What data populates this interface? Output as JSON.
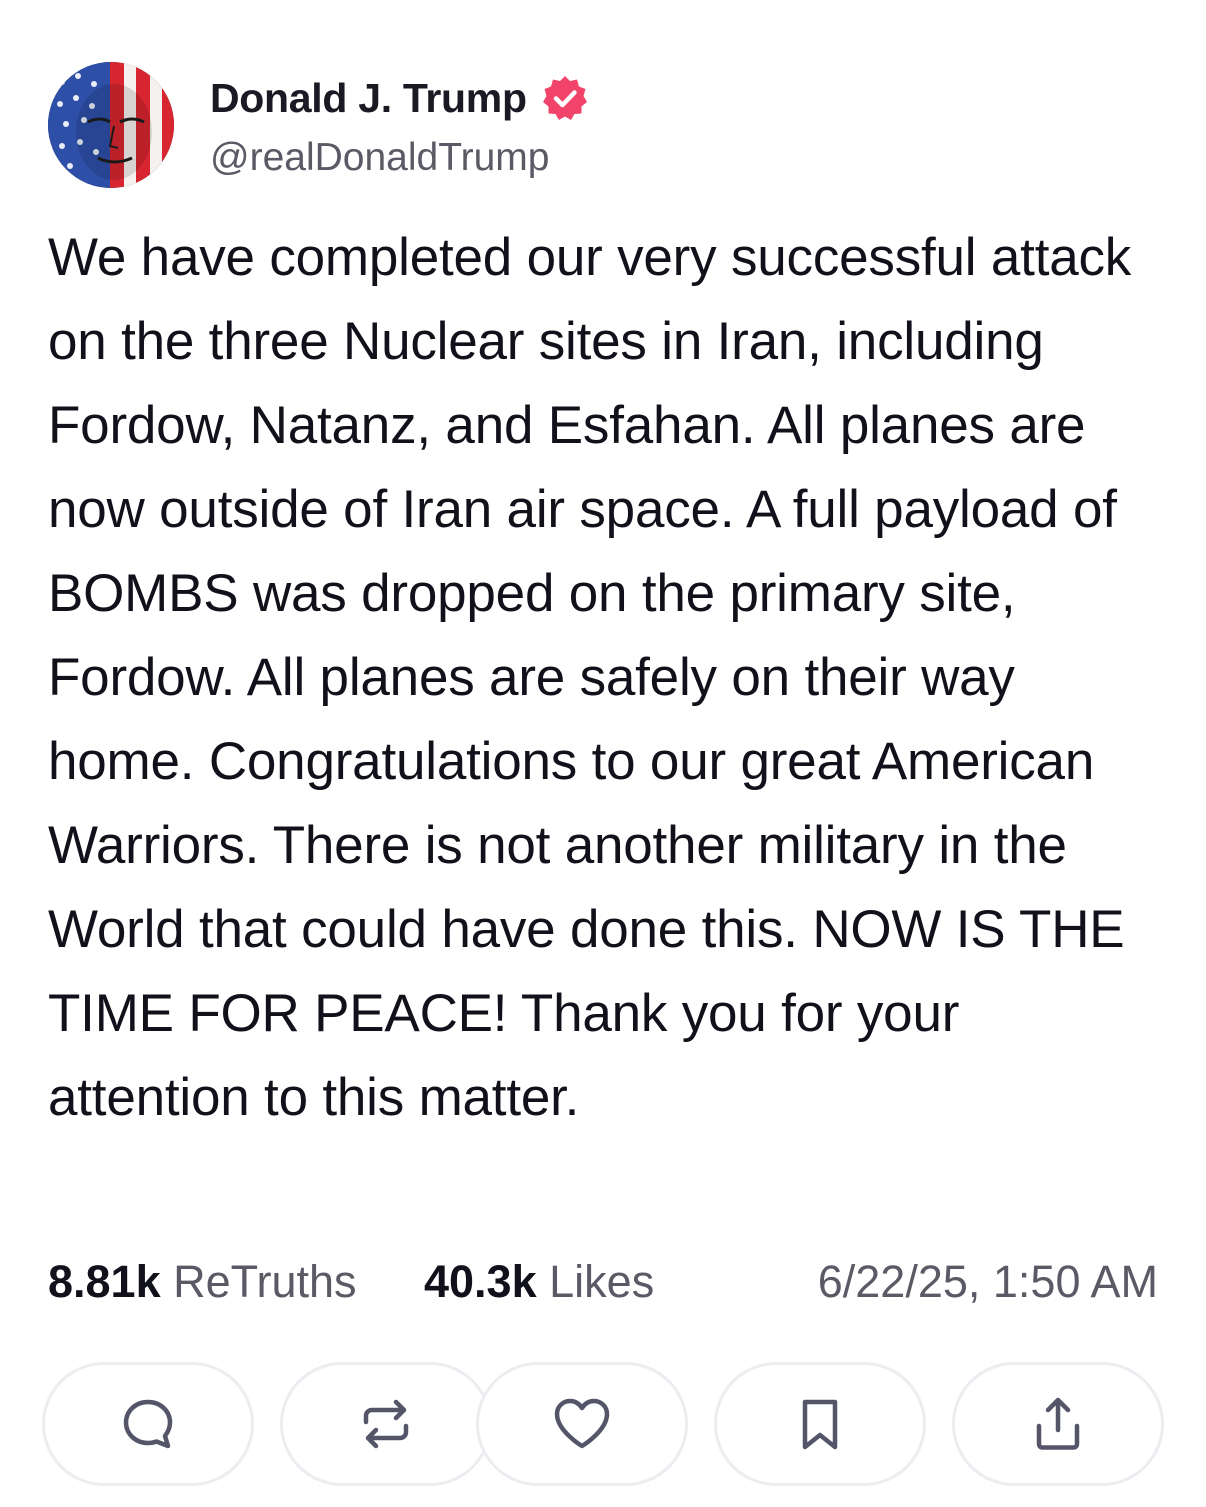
{
  "post": {
    "author": {
      "display_name": "Donald J. Trump",
      "handle": "@realDonaldTrump",
      "verified": true,
      "avatar_icon": "flag-portrait-avatar"
    },
    "body": "We have completed our very successful attack on the three Nuclear sites in Iran, including Fordow, Natanz, and Esfahan. All planes are now outside of Iran air space. A full payload of BOMBS was dropped on the primary site, Fordow. All planes are safely on their way home. Congratulations to our great American Warriors. There is not another military in the World that could have done this. NOW IS THE TIME FOR PEACE! Thank you for your attention to this matter.",
    "stats": {
      "retruths_count": "8.81k",
      "retruths_label": "ReTruths",
      "likes_count": "40.3k",
      "likes_label": "Likes"
    },
    "timestamp": "6/22/25, 1:50 AM"
  },
  "actions": [
    {
      "name": "reply",
      "icon": "speech-bubble-icon"
    },
    {
      "name": "retruth",
      "icon": "repost-arrows-icon"
    },
    {
      "name": "like",
      "icon": "heart-icon"
    },
    {
      "name": "bookmark",
      "icon": "bookmark-icon"
    },
    {
      "name": "share",
      "icon": "share-upload-icon"
    }
  ],
  "colors": {
    "verified_badge": "#f2446b",
    "text_primary": "#11111b",
    "text_secondary": "#5a5a66",
    "icon": "#55556a",
    "button_border": "#ececf1"
  }
}
